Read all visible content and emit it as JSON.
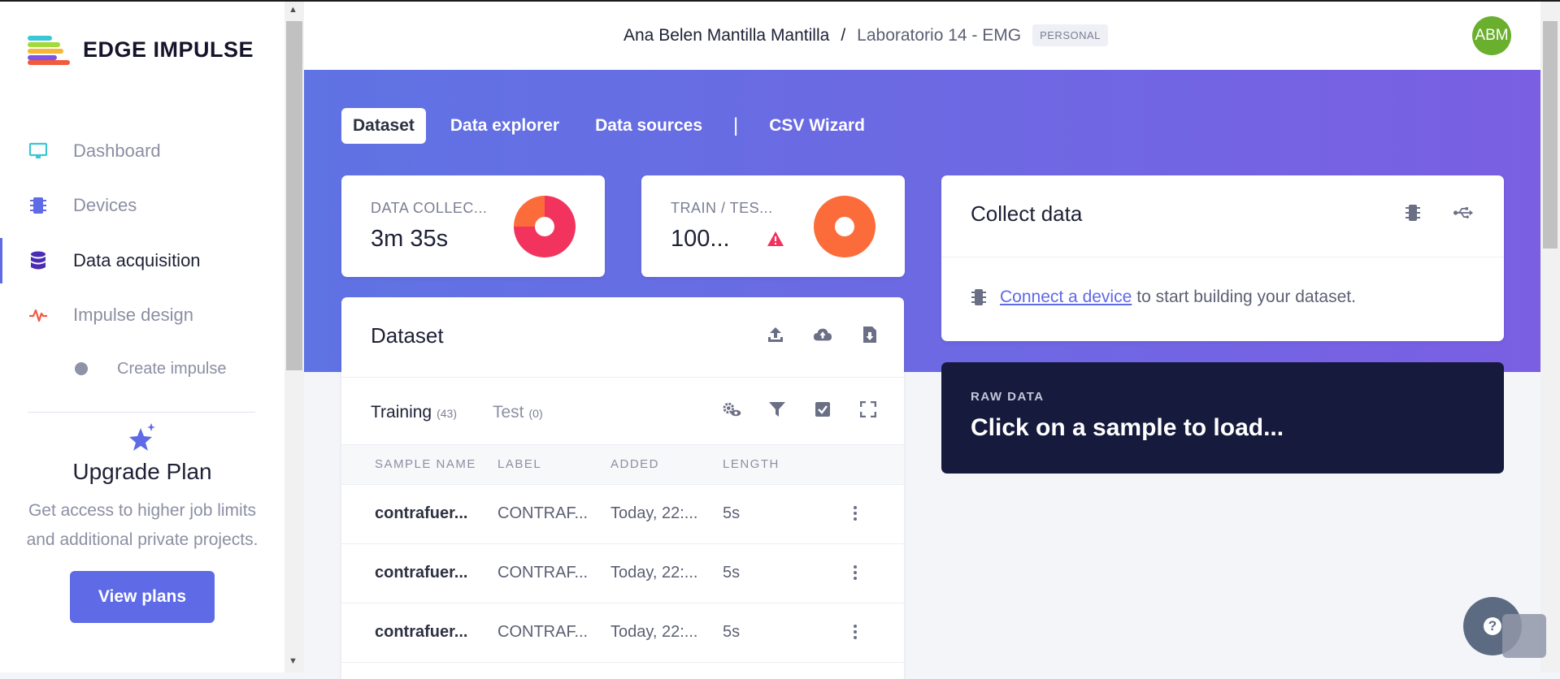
{
  "brand": {
    "name": "EDGE IMPULSE"
  },
  "sidebar": {
    "items": [
      {
        "label": "Dashboard",
        "icon": "monitor-icon"
      },
      {
        "label": "Devices",
        "icon": "chip-icon"
      },
      {
        "label": "Data acquisition",
        "icon": "database-icon",
        "active": true
      },
      {
        "label": "Impulse design",
        "icon": "pulse-icon"
      }
    ],
    "sub_items": [
      {
        "label": "Create impulse"
      }
    ],
    "upgrade": {
      "title": "Upgrade Plan",
      "text": "Get access to higher job limits and additional private projects.",
      "button": "View plans"
    }
  },
  "header": {
    "owner": "Ana Belen Mantilla Mantilla",
    "separator": "/",
    "project": "Laboratorio 14 - EMG",
    "badge": "PERSONAL",
    "avatar": "ABM"
  },
  "tabs": [
    {
      "label": "Dataset",
      "active": true
    },
    {
      "label": "Data explorer"
    },
    {
      "label": "Data sources"
    },
    {
      "label": "CSV Wizard"
    }
  ],
  "tab_separator": "|",
  "stats": {
    "collected": {
      "label": "DATA COLLEC...",
      "value": "3m 35s"
    },
    "split": {
      "label": "TRAIN / TES...",
      "value": "100..."
    }
  },
  "dataset": {
    "title": "Dataset",
    "subtabs": [
      {
        "label": "Training",
        "count": "(43)",
        "active": true
      },
      {
        "label": "Test",
        "count": "(0)"
      }
    ],
    "columns": [
      "SAMPLE NAME",
      "LABEL",
      "ADDED",
      "LENGTH"
    ],
    "rows": [
      {
        "name": "contrafuer...",
        "label": "CONTRAF...",
        "added": "Today, 22:...",
        "length": "5s"
      },
      {
        "name": "contrafuer...",
        "label": "CONTRAF...",
        "added": "Today, 22:...",
        "length": "5s"
      },
      {
        "name": "contrafuer...",
        "label": "CONTRAF...",
        "added": "Today, 22:...",
        "length": "5s"
      }
    ]
  },
  "collect": {
    "title": "Collect data",
    "link": "Connect a device",
    "rest": "to start building your dataset."
  },
  "raw": {
    "small": "RAW DATA",
    "big": "Click on a sample to load..."
  },
  "help": {
    "symbol": "?"
  },
  "colors": {
    "accent": "#5e6ae6",
    "hero_start": "#5f73e3",
    "hero_end": "#7a5fe3",
    "donut_pink": "#f2335d",
    "donut_orange": "#fc6c3a",
    "warning": "#f2335d"
  }
}
